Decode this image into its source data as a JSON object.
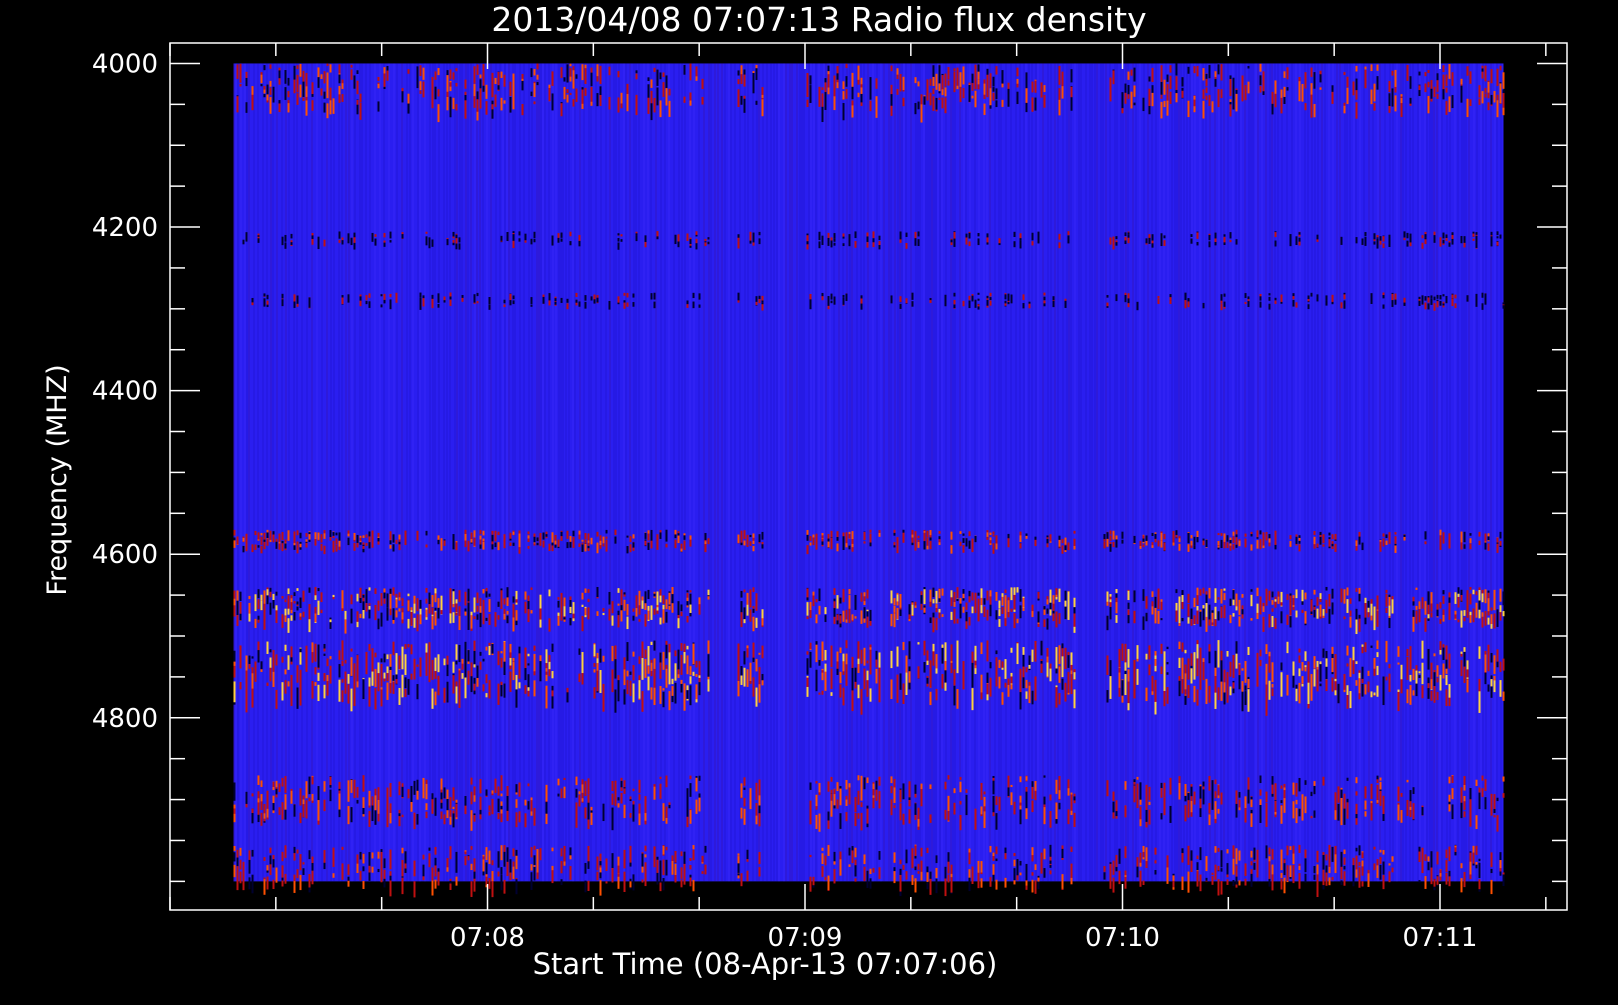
{
  "chart_data": {
    "type": "heatmap",
    "title": "2013/04/08 07:07:13 Radio flux density",
    "xlabel": "Start Time (08-Apr-13 07:07:06)",
    "ylabel": "Frequency (MHZ)",
    "x_ticks": [
      {
        "label": "07:08",
        "seconds": 54
      },
      {
        "label": "07:09",
        "seconds": 114
      },
      {
        "label": "07:10",
        "seconds": 174
      },
      {
        "label": "07:11",
        "seconds": 234
      }
    ],
    "x_range_seconds": [
      -6,
      258
    ],
    "data_x_range_seconds": [
      6,
      246
    ],
    "y_ticks": [
      4000,
      4200,
      4400,
      4600,
      4800
    ],
    "y_range": [
      3975,
      5035
    ],
    "data_y_range": [
      4000,
      5000
    ],
    "y_minor_step": 50,
    "x_minor_step_seconds": 20,
    "y_reversed": true,
    "colors": {
      "background": "#000000",
      "axes": "#ffffff",
      "base": "#2a1ef0",
      "dark": "#000030",
      "red": "#c01010",
      "orange": "#ff5000",
      "yellow": "#ffd040"
    },
    "bands_mhz": [
      {
        "from": 4000,
        "to": 4050,
        "intensity": "moderate"
      },
      {
        "from": 4205,
        "to": 4220,
        "intensity": "weak"
      },
      {
        "from": 4280,
        "to": 4295,
        "intensity": "weak"
      },
      {
        "from": 4570,
        "to": 4590,
        "intensity": "moderate"
      },
      {
        "from": 4640,
        "to": 4680,
        "intensity": "strong"
      },
      {
        "from": 4705,
        "to": 4770,
        "intensity": "strong"
      },
      {
        "from": 4870,
        "to": 4920,
        "intensity": "moderate"
      },
      {
        "from": 4955,
        "to": 5000,
        "intensity": "moderate"
      }
    ],
    "active_times_seconds": [
      [
        6,
        96
      ],
      [
        101,
        106
      ],
      [
        114,
        128
      ],
      [
        130,
        165
      ],
      [
        170,
        246
      ]
    ]
  }
}
